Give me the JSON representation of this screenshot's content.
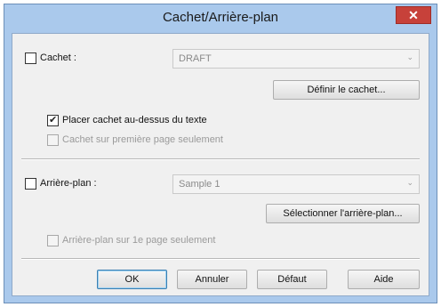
{
  "window": {
    "title": "Cachet/Arrière-plan",
    "close_label": "✕"
  },
  "stamp": {
    "checkbox_label": "Cachet :",
    "checked": false,
    "select_value": "DRAFT",
    "define_button": "Définir le cachet...",
    "over_text_label": "Placer cachet au-dessus du texte",
    "over_text_checked": true,
    "first_page_label": "Cachet sur première page seulement",
    "first_page_checked": false
  },
  "background": {
    "checkbox_label": "Arrière-plan :",
    "checked": false,
    "select_value": "Sample 1",
    "select_button": "Sélectionner l'arrière-plan...",
    "first_page_label": "Arrière-plan sur 1e page seulement",
    "first_page_checked": false
  },
  "buttons": {
    "ok": "OK",
    "cancel": "Annuler",
    "default": "Défaut",
    "help": "Aide"
  },
  "colors": {
    "window_frame": "#aac9ec",
    "close_button": "#c7413a",
    "client_bg": "#f0f0f0"
  },
  "icons": {
    "close": "close-icon",
    "dropdown": "chevron-down-icon",
    "check": "checkmark-icon"
  }
}
